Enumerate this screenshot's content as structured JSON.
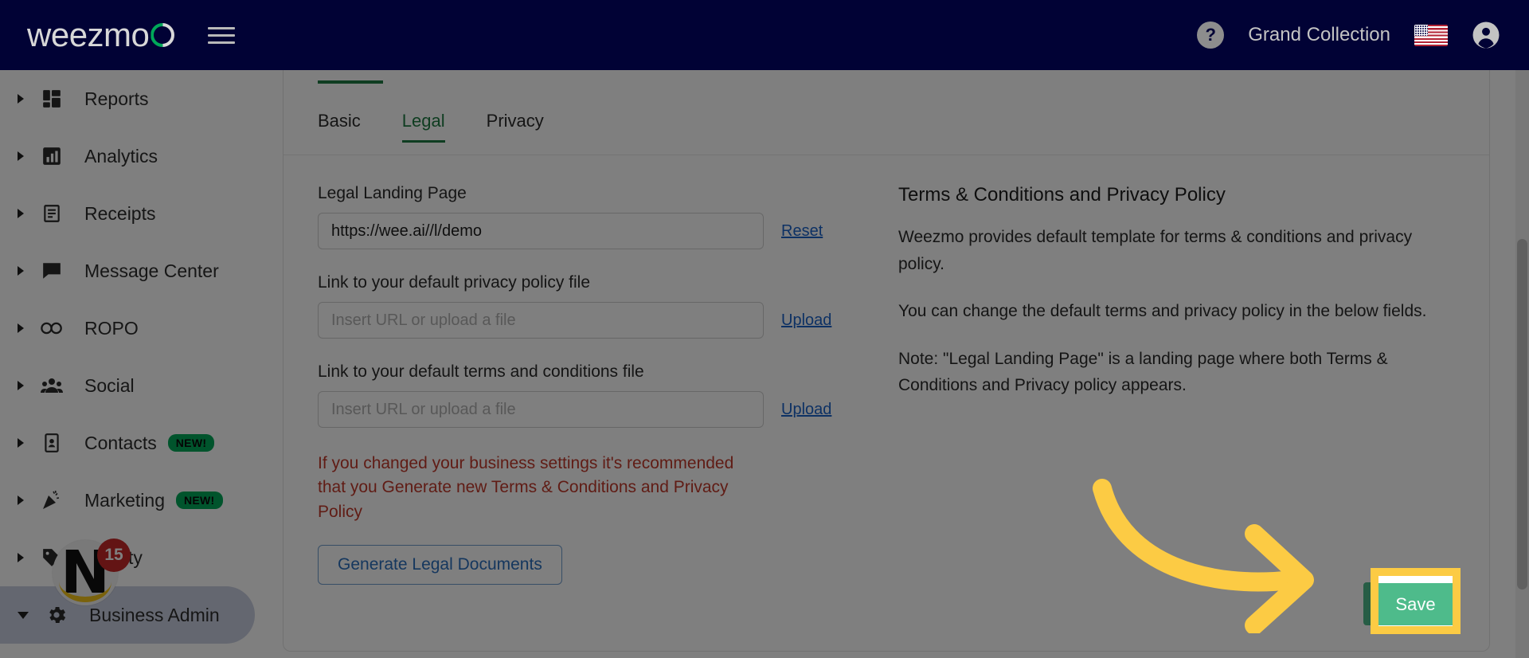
{
  "header": {
    "logo_text": "weezmo",
    "logo_icon": "weezmo-logo",
    "menu_icon": "hamburger-menu-icon",
    "help_icon": "question-mark-icon",
    "help_label": "?",
    "business_name": "Grand Collection",
    "flag_icon": "us-flag-icon",
    "account_icon": "account-avatar-icon"
  },
  "sidebar": {
    "items": [
      {
        "label": "Reports",
        "icon": "dashboard-grid-icon",
        "badge": "",
        "expanded": false,
        "active": false
      },
      {
        "label": "Analytics",
        "icon": "bar-chart-icon",
        "badge": "",
        "expanded": false,
        "active": false
      },
      {
        "label": "Receipts",
        "icon": "receipt-icon",
        "badge": "",
        "expanded": false,
        "active": false
      },
      {
        "label": "Message Center",
        "icon": "chat-bubble-icon",
        "badge": "",
        "expanded": false,
        "active": false
      },
      {
        "label": "ROPO",
        "icon": "infinity-icon",
        "badge": "",
        "expanded": false,
        "active": false
      },
      {
        "label": "Social",
        "icon": "people-group-icon",
        "badge": "",
        "expanded": false,
        "active": false
      },
      {
        "label": "Contacts",
        "icon": "contact-card-icon",
        "badge": "NEW!",
        "expanded": false,
        "active": false
      },
      {
        "label": "Marketing",
        "icon": "megaphone-icon",
        "badge": "NEW!",
        "expanded": false,
        "active": false
      },
      {
        "label": "Loyalty",
        "icon": "tag-icon",
        "badge": "",
        "expanded": false,
        "active": false
      },
      {
        "label": "Business Admin",
        "icon": "gear-icon",
        "badge": "",
        "expanded": true,
        "active": true
      }
    ],
    "notification_count": "15",
    "overlay_logo": "N"
  },
  "main": {
    "tabs": [
      {
        "label": "Basic",
        "active": false
      },
      {
        "label": "Legal",
        "active": true
      },
      {
        "label": "Privacy",
        "active": false
      }
    ],
    "fields": [
      {
        "label": "Legal Landing Page",
        "value": "https://wee.ai//l/demo",
        "placeholder": "",
        "action": "Reset"
      },
      {
        "label": "Link to your default privacy policy file",
        "value": "",
        "placeholder": "Insert URL or upload a file",
        "action": "Upload"
      },
      {
        "label": "Link to your default terms and conditions file",
        "value": "",
        "placeholder": "Insert URL or upload a file",
        "action": "Upload"
      }
    ],
    "warning_text": "If you changed your business settings it's recommended that you Generate new Terms & Conditions and Privacy Policy",
    "generate_button": "Generate Legal Documents",
    "info": {
      "title": "Terms & Conditions and Privacy Policy",
      "paragraphs": [
        "Weezmo provides default template for terms & conditions and privacy policy.",
        "You can change the default terms and privacy policy in the below fields.",
        "Note: \"Legal Landing Page\" is a landing page where both Terms & Conditions and Privacy policy appears."
      ]
    },
    "save_button": "Save"
  },
  "annotation": {
    "arrow_icon": "curved-right-arrow-annotation",
    "highlight_color": "#FCCB44",
    "highlight_target": "Save"
  },
  "colors": {
    "header_bg": "#010235",
    "accent_green": "#1f7a42",
    "save_green": "#4ebb8b",
    "warning_red": "#c0392b",
    "link_blue": "#1b62c9",
    "badge_green": "#00a859",
    "count_red": "#c62828",
    "highlight_yellow": "#FCCB44"
  }
}
